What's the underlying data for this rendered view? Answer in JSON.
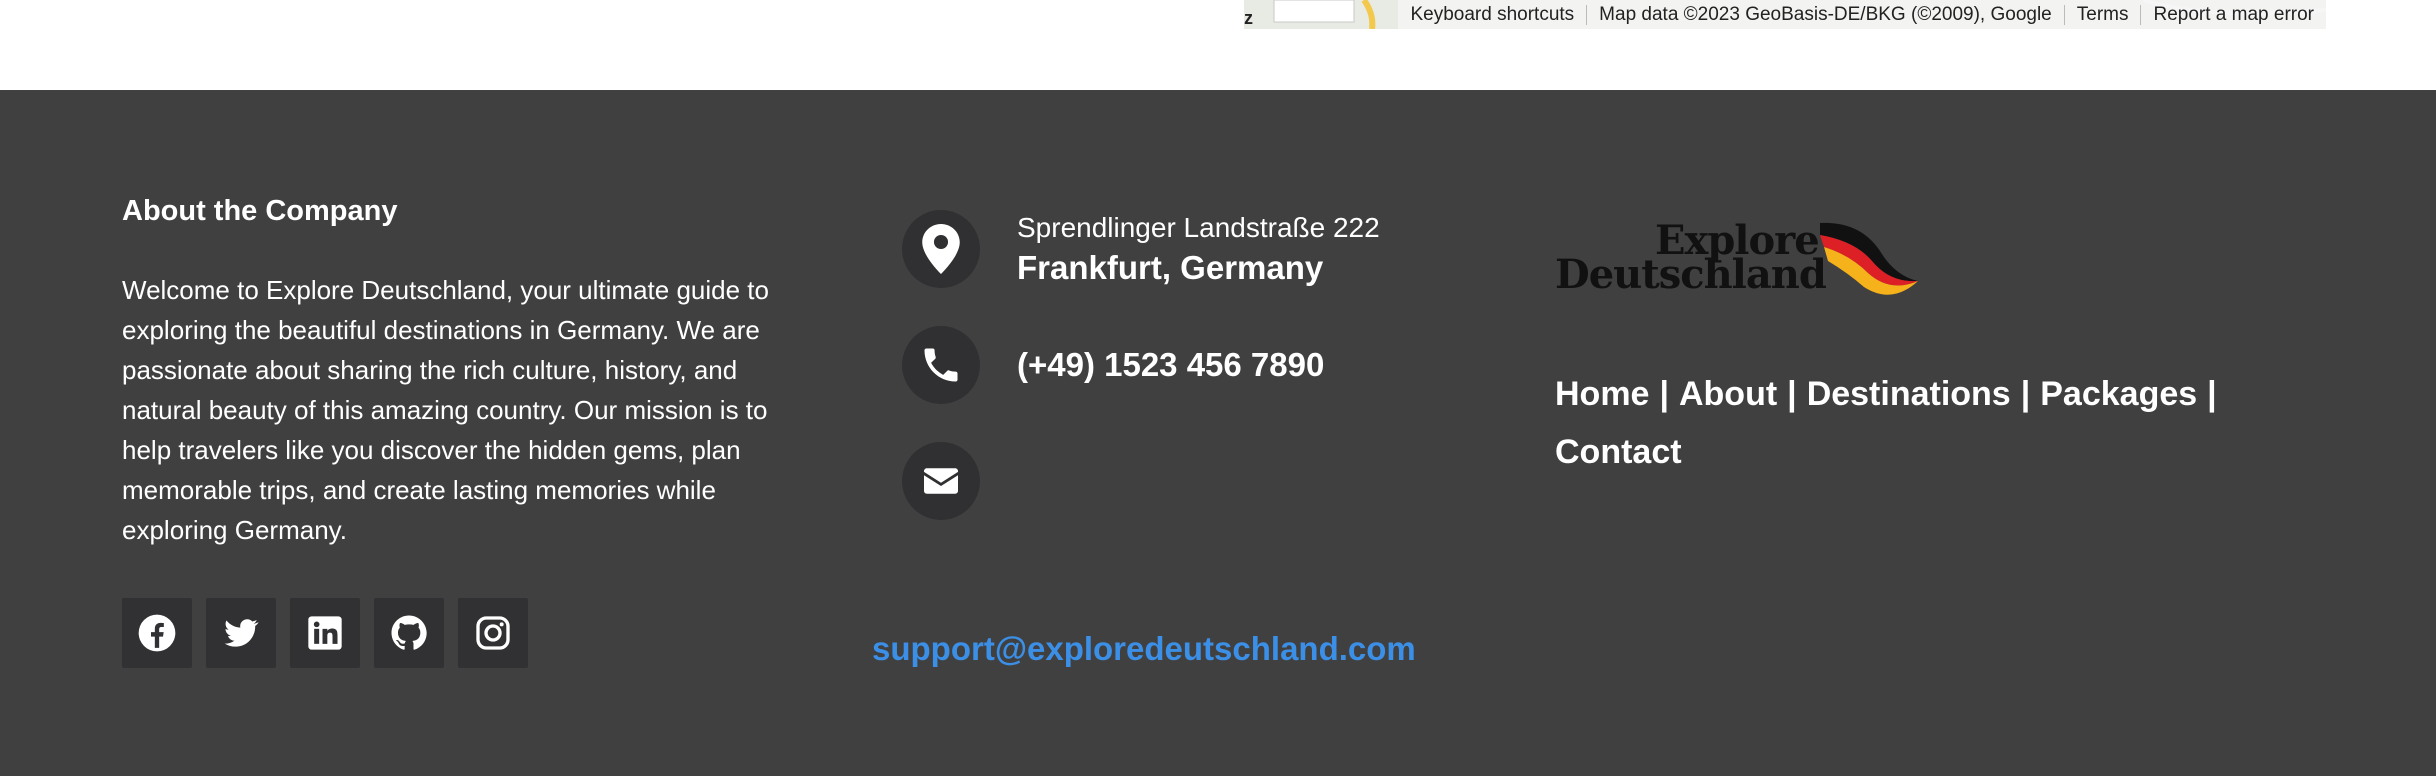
{
  "map": {
    "left_mark": "z",
    "credits": [
      "Keyboard shortcuts",
      "Map data ©2023 GeoBasis-DE/BKG (©2009), Google",
      "Terms",
      "Report a map error"
    ]
  },
  "about": {
    "title": "About the Company",
    "text": "Welcome to Explore Deutschland, your ultimate guide to exploring the beautiful destinations in Germany. We are passionate about sharing the rich culture, history, and natural beauty of this amazing country. Our mission is to help travelers like you discover the hidden gems, plan memorable trips, and create lasting memories while exploring Germany.",
    "social": [
      "facebook-icon",
      "twitter-icon",
      "linkedin-icon",
      "github-icon",
      "instagram-icon"
    ]
  },
  "contact": {
    "address_line1": "Sprendlinger Landstraße 222",
    "address_line2": "Frankfurt, Germany",
    "phone": "(+49) 1523 456 7890",
    "email": "support@exploredeutschland.com",
    "email_color": "#3b8fe6"
  },
  "brand": {
    "logo_line1": "Explore",
    "logo_line2": "Deutschland",
    "nav": [
      "Home",
      "About",
      "Destinations",
      "Packages",
      "Contact"
    ],
    "separator": "|"
  },
  "colors": {
    "footer_bg": "#404041",
    "icon_bg": "#303032"
  }
}
